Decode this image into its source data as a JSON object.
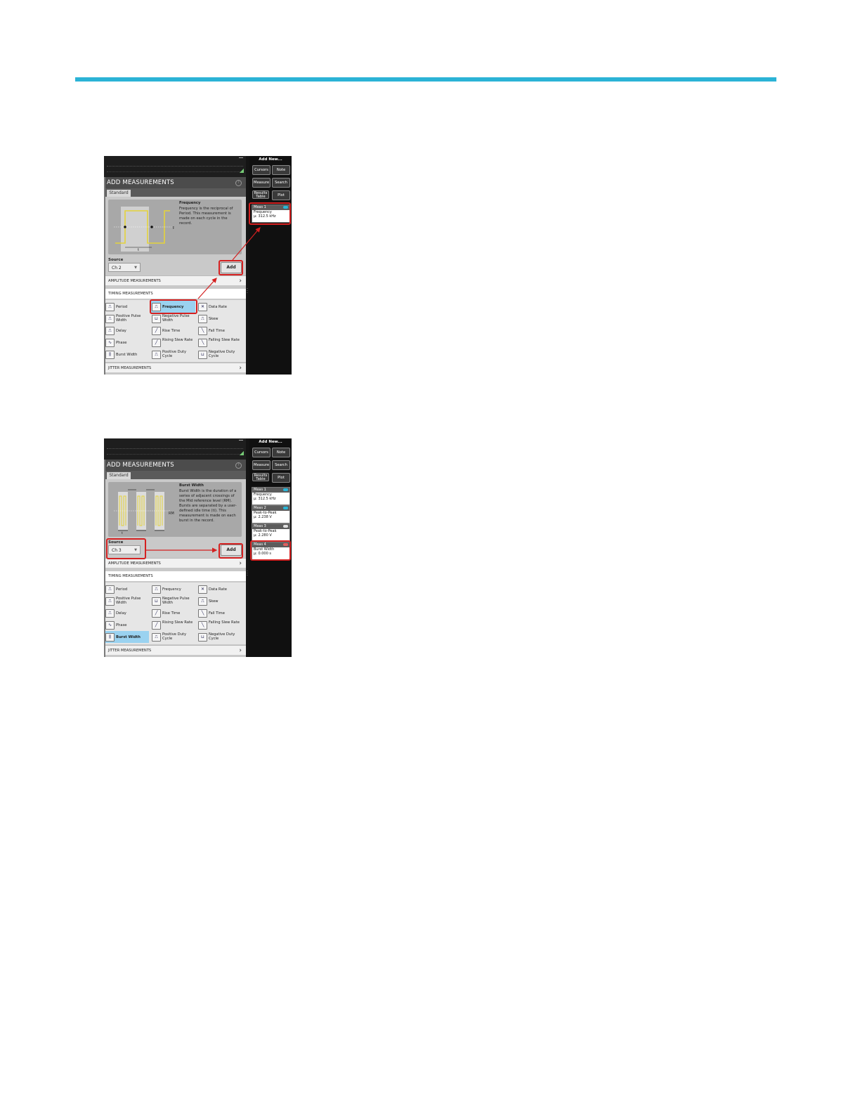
{
  "colors": {
    "accent_bar": "#2bb3d6",
    "highlight": "#d42020",
    "selected": "#9ad2f0"
  },
  "screens": [
    {
      "panel_title": "ADD MEASUREMENTS",
      "tab": "Standard",
      "desc_title": "Frequency",
      "desc_text": "Frequency is the reciprocal of Period. This measurement is made on each cycle in the record.",
      "diagram_label": "t",
      "source_label": "Source",
      "source_value": "Ch 2",
      "add_label": "Add",
      "amplitude": "AMPLITUDE MEASUREMENTS",
      "timing": "TIMING MEASUREMENTS",
      "jitter": "JITTER MEASUREMENTS",
      "cells": {
        "period": "Period",
        "frequency": "Frequency",
        "data_rate": "Data Rate",
        "pos_pulse": "Positive Pulse Width",
        "neg_pulse": "Negative Pulse Width",
        "skew": "Skew",
        "delay": "Delay",
        "rise": "Rise Time",
        "fall": "Fall Time",
        "phase": "Phase",
        "rising_slew": "Rising Slew Rate",
        "falling_slew": "Falling Slew Rate",
        "burst": "Burst Width",
        "pos_duty": "Positive Duty Cycle",
        "neg_duty": "Negative Duty Cycle"
      },
      "side": {
        "add_new": "Add New...",
        "cursors": "Cursors",
        "note": "Note",
        "measure": "Measure",
        "search": "Search",
        "results_table": "Results Table",
        "plot": "Plot"
      },
      "meas": [
        {
          "title": "Meas 1",
          "name": "Frequency",
          "value": "μ: 312.5 kHz",
          "color": "#29b6d8"
        }
      ]
    },
    {
      "panel_title": "ADD MEASUREMENTS",
      "tab": "Standard",
      "desc_title": "Burst Width",
      "desc_text": "Burst Width is the duration of a series of adjacent crossings of the Mid reference level (RM). Bursts are separated by a user-defined idle time (ti). This measurement is made on each burst in the record.",
      "diagram_label": "t",
      "source_label": "Source",
      "source_value": "Ch 3",
      "add_label": "Add",
      "amplitude": "AMPLITUDE MEASUREMENTS",
      "timing": "TIMING MEASUREMENTS",
      "jitter": "JITTER MEASUREMENTS",
      "cells": {
        "period": "Period",
        "frequency": "Frequency",
        "data_rate": "Data Rate",
        "pos_pulse": "Positive Pulse Width",
        "neg_pulse": "Negative Pulse Width",
        "skew": "Skew",
        "delay": "Delay",
        "rise": "Rise Time",
        "fall": "Fall Time",
        "phase": "Phase",
        "rising_slew": "Rising Slew Rate",
        "falling_slew": "Falling Slew Rate",
        "burst": "Burst Width",
        "pos_duty": "Positive Duty Cycle",
        "neg_duty": "Negative Duty Cycle"
      },
      "side": {
        "add_new": "Add New...",
        "cursors": "Cursors",
        "note": "Note",
        "measure": "Measure",
        "search": "Search",
        "results_table": "Results Table",
        "plot": "Plot"
      },
      "meas": [
        {
          "title": "Meas 1",
          "name": "Frequency",
          "value": "μ: 312.5 kHz",
          "color": "#29b6d8"
        },
        {
          "title": "Meas 2",
          "name": "Peak-to-Peak",
          "value": "μ: 2.238 V",
          "color": "#29b6d8"
        },
        {
          "title": "Meas 3",
          "name": "Peak-to-Peak",
          "value": "μ: 2.280 V",
          "color": "#e0e0e0"
        },
        {
          "title": "Meas 4",
          "name": "Burst Width",
          "value": "μ: 0.000 s",
          "color": "#e06060"
        }
      ]
    }
  ]
}
